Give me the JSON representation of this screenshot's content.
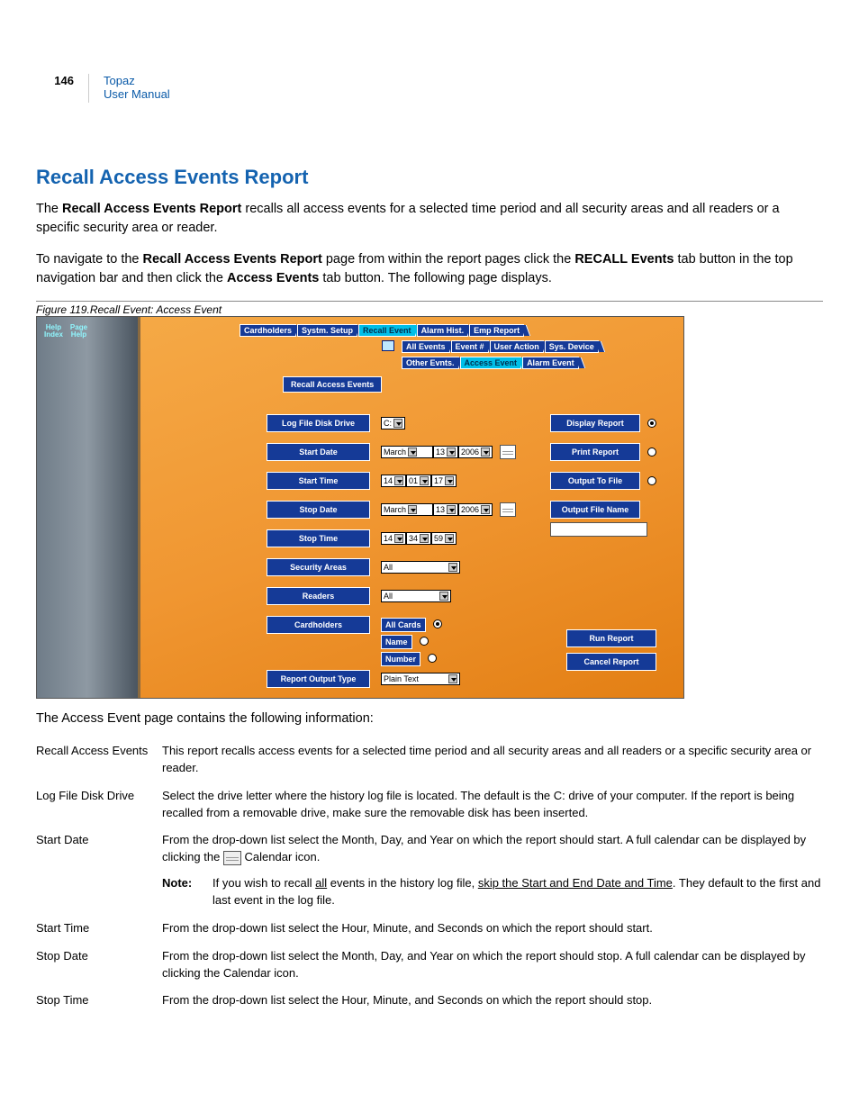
{
  "hdr": {
    "page": "146",
    "title": "Topaz",
    "sub": "User Manual"
  },
  "h1": "Recall Access Events Report",
  "p1": {
    "a": "The ",
    "b": "Recall Access Events Report",
    "c": " recalls all access events for a selected time period and all security areas and all readers or a specific security area or reader."
  },
  "p2": {
    "a": "To navigate to the ",
    "b": "Recall Access Events Report",
    "c": " page from within the report pages click the ",
    "d": "RECALL Events",
    "e": " tab button in the top navigation bar and then click the ",
    "f": "Access Events",
    "g": " tab button. The following page displays."
  },
  "caption": "Figure 119.Recall Event: Access Event",
  "shot": {
    "help1a": "Help",
    "help1b": "Index",
    "help2a": "Page",
    "help2b": "Help",
    "tabs1": [
      "Cardholders",
      "Systm. Setup",
      "Recall Event",
      "Alarm Hist.",
      "Emp Report"
    ],
    "tabs2": [
      "All Events",
      "Event #",
      "User Action",
      "Sys. Device"
    ],
    "tabs3": [
      "Other Evnts.",
      "Access Event",
      "Alarm Event"
    ],
    "panelTitle": "Recall Access Events",
    "labels": {
      "logdrive": "Log File Disk Drive",
      "startdate": "Start Date",
      "starttime": "Start Time",
      "stopdate": "Stop Date",
      "stoptime": "Stop Time",
      "secareas": "Security Areas",
      "readers": "Readers",
      "cardholders": "Cardholders",
      "outtype": "Report Output Type"
    },
    "vals": {
      "drive": "C:",
      "month": "March",
      "day": "13",
      "year": "2006",
      "h": "14",
      "m1": "01",
      "s1": "17",
      "m2": "34",
      "s2": "59",
      "all": "All",
      "allcards": "All Cards",
      "name": "Name",
      "number": "Number",
      "outtype": "Plain Text"
    },
    "right": {
      "display": "Display Report",
      "print": "Print Report",
      "output": "Output To File",
      "outname": "Output File Name",
      "run": "Run Report",
      "cancel": "Cancel Report"
    }
  },
  "afterShot": "The Access Event page contains the following information:",
  "defs": [
    {
      "term": "Recall Access Events",
      "defn": "This report recalls access events for a selected time period and all security areas and all readers or a specific security area or reader."
    },
    {
      "term": "Log File Disk Drive",
      "defn": "Select the drive letter where the history log file is located. The default is the C: drive of your computer. If the report is being recalled from a removable drive, make sure the removable disk has been inserted."
    }
  ],
  "startDate": {
    "term": "Start Date",
    "d1": "From the drop-down list select the Month, Day, and Year on which the report should start. A full calendar can be displayed by clicking the ",
    "d2": " Calendar icon.",
    "noteLbl": "Note:",
    "noteA": "If you wish to recall ",
    "noteU1": "all",
    "noteB": " events in the history log file, ",
    "noteU2": "skip the Start and End Date and Time",
    "noteC": ". They default to the first and last event in the log file."
  },
  "tail": [
    {
      "term": "Start Time",
      "defn": "From the drop-down list select the Hour, Minute, and Seconds on which the report should start."
    },
    {
      "term": "Stop Date",
      "defn": "From the drop-down list select the Month, Day, and Year on which the report should stop. A full calendar can be displayed by clicking the Calendar icon."
    },
    {
      "term": "Stop Time",
      "defn": "From the drop-down list select the Hour, Minute, and Seconds on which the report should stop."
    }
  ]
}
